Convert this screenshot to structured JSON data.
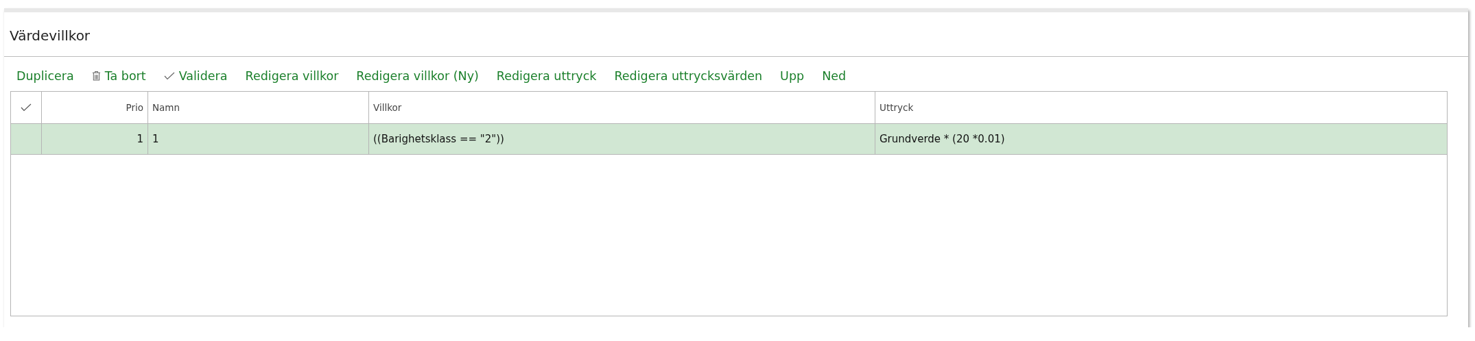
{
  "panel": {
    "title": "Värdevillkor"
  },
  "toolbar": [
    {
      "label": "Duplicera",
      "kind": "plain"
    },
    {
      "label": "Ta bort",
      "kind": "delete"
    },
    {
      "label": "Validera",
      "kind": "validate"
    },
    {
      "label": "Redigera villkor",
      "kind": "plain"
    },
    {
      "label": "Redigera villkor (Ny)",
      "kind": "plain"
    },
    {
      "label": "Redigera uttryck",
      "kind": "plain"
    },
    {
      "label": "Redigera uttrycksvärden",
      "kind": "plain"
    },
    {
      "label": "Upp",
      "kind": "plain"
    },
    {
      "label": "Ned",
      "kind": "plain"
    }
  ],
  "table": {
    "columns": [
      "Prio",
      "Namn",
      "Villkor",
      "Uttryck"
    ],
    "rows": [
      {
        "cells": [
          "1",
          "1",
          "((Barighetsklass == \"2\"))",
          "Grundverde * (20 *0.01)"
        ],
        "selected": true
      }
    ]
  }
}
